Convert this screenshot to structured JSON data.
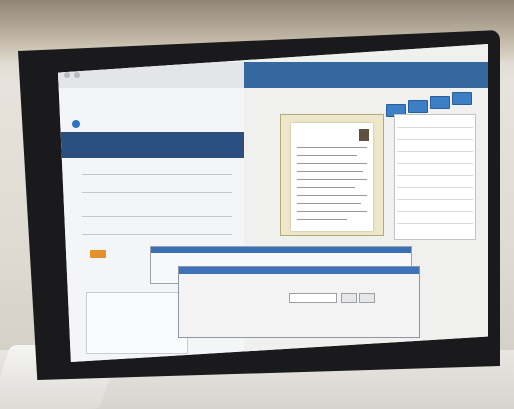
{
  "browser": {
    "banner_links": [
      "",
      ""
    ],
    "button_label": ""
  },
  "app": {
    "title": "",
    "side_buttons": [
      "",
      "",
      "",
      ""
    ]
  },
  "dialog": {
    "title": "",
    "buttons": [
      "",
      ""
    ]
  },
  "colors": {
    "banner": "#2a4f80",
    "app_header": "#34689f",
    "dialog_titlebar": "#3e73b9",
    "accent_button": "#e4912c"
  }
}
